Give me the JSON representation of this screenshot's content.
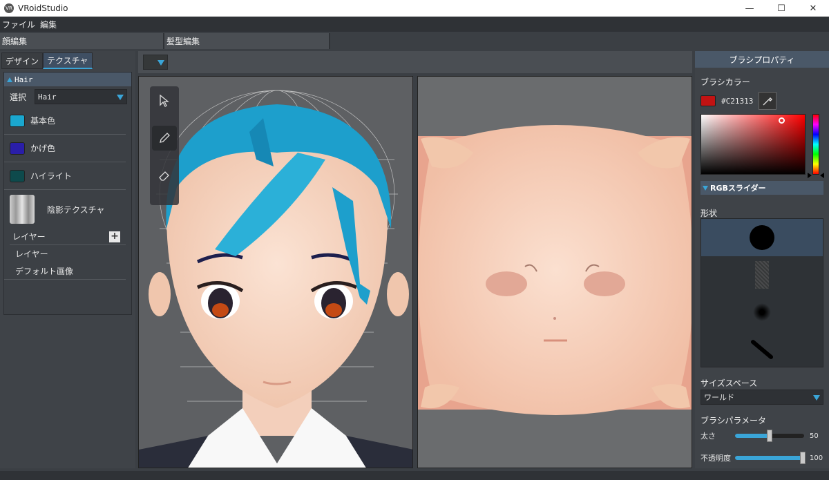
{
  "window": {
    "title": "VRoidStudio",
    "icon_text": "VR"
  },
  "menu": [
    "ファイル",
    "編集"
  ],
  "edit_tabs": [
    "顔編集",
    "髪型編集"
  ],
  "sub_tabs": [
    "デザイン",
    "テクスチャ"
  ],
  "hair_panel": {
    "header": "Hair",
    "select_label": "選択",
    "select_value": "Hair",
    "colors": [
      {
        "label": "基本色",
        "color": "#1AA7CF"
      },
      {
        "label": "かげ色",
        "color": "#2A1EA8"
      },
      {
        "label": "ハイライト",
        "color": "#0E4A4C"
      }
    ],
    "shadow_texture_label": "陰影テクスチャ",
    "layers_label": "レイヤー",
    "layers": [
      "レイヤー",
      "デフォルト画像"
    ]
  },
  "brush_panel": {
    "header": "ブラシプロパティ",
    "brush_color_label": "ブラシカラー",
    "hex": "#C21313",
    "swatch_color": "#C21313",
    "rgb_slider_label": "RGBスライダー",
    "shape_label": "形状",
    "size_space_label": "サイズスペース",
    "size_space_value": "ワールド",
    "params_label": "ブラシパラメータ",
    "params": [
      {
        "label": "太さ",
        "value": "50",
        "level": 0.5
      },
      {
        "label": "不透明度",
        "value": "100",
        "level": 1.0
      }
    ]
  },
  "tools": [
    "select-icon",
    "pen-icon",
    "eraser-icon"
  ]
}
